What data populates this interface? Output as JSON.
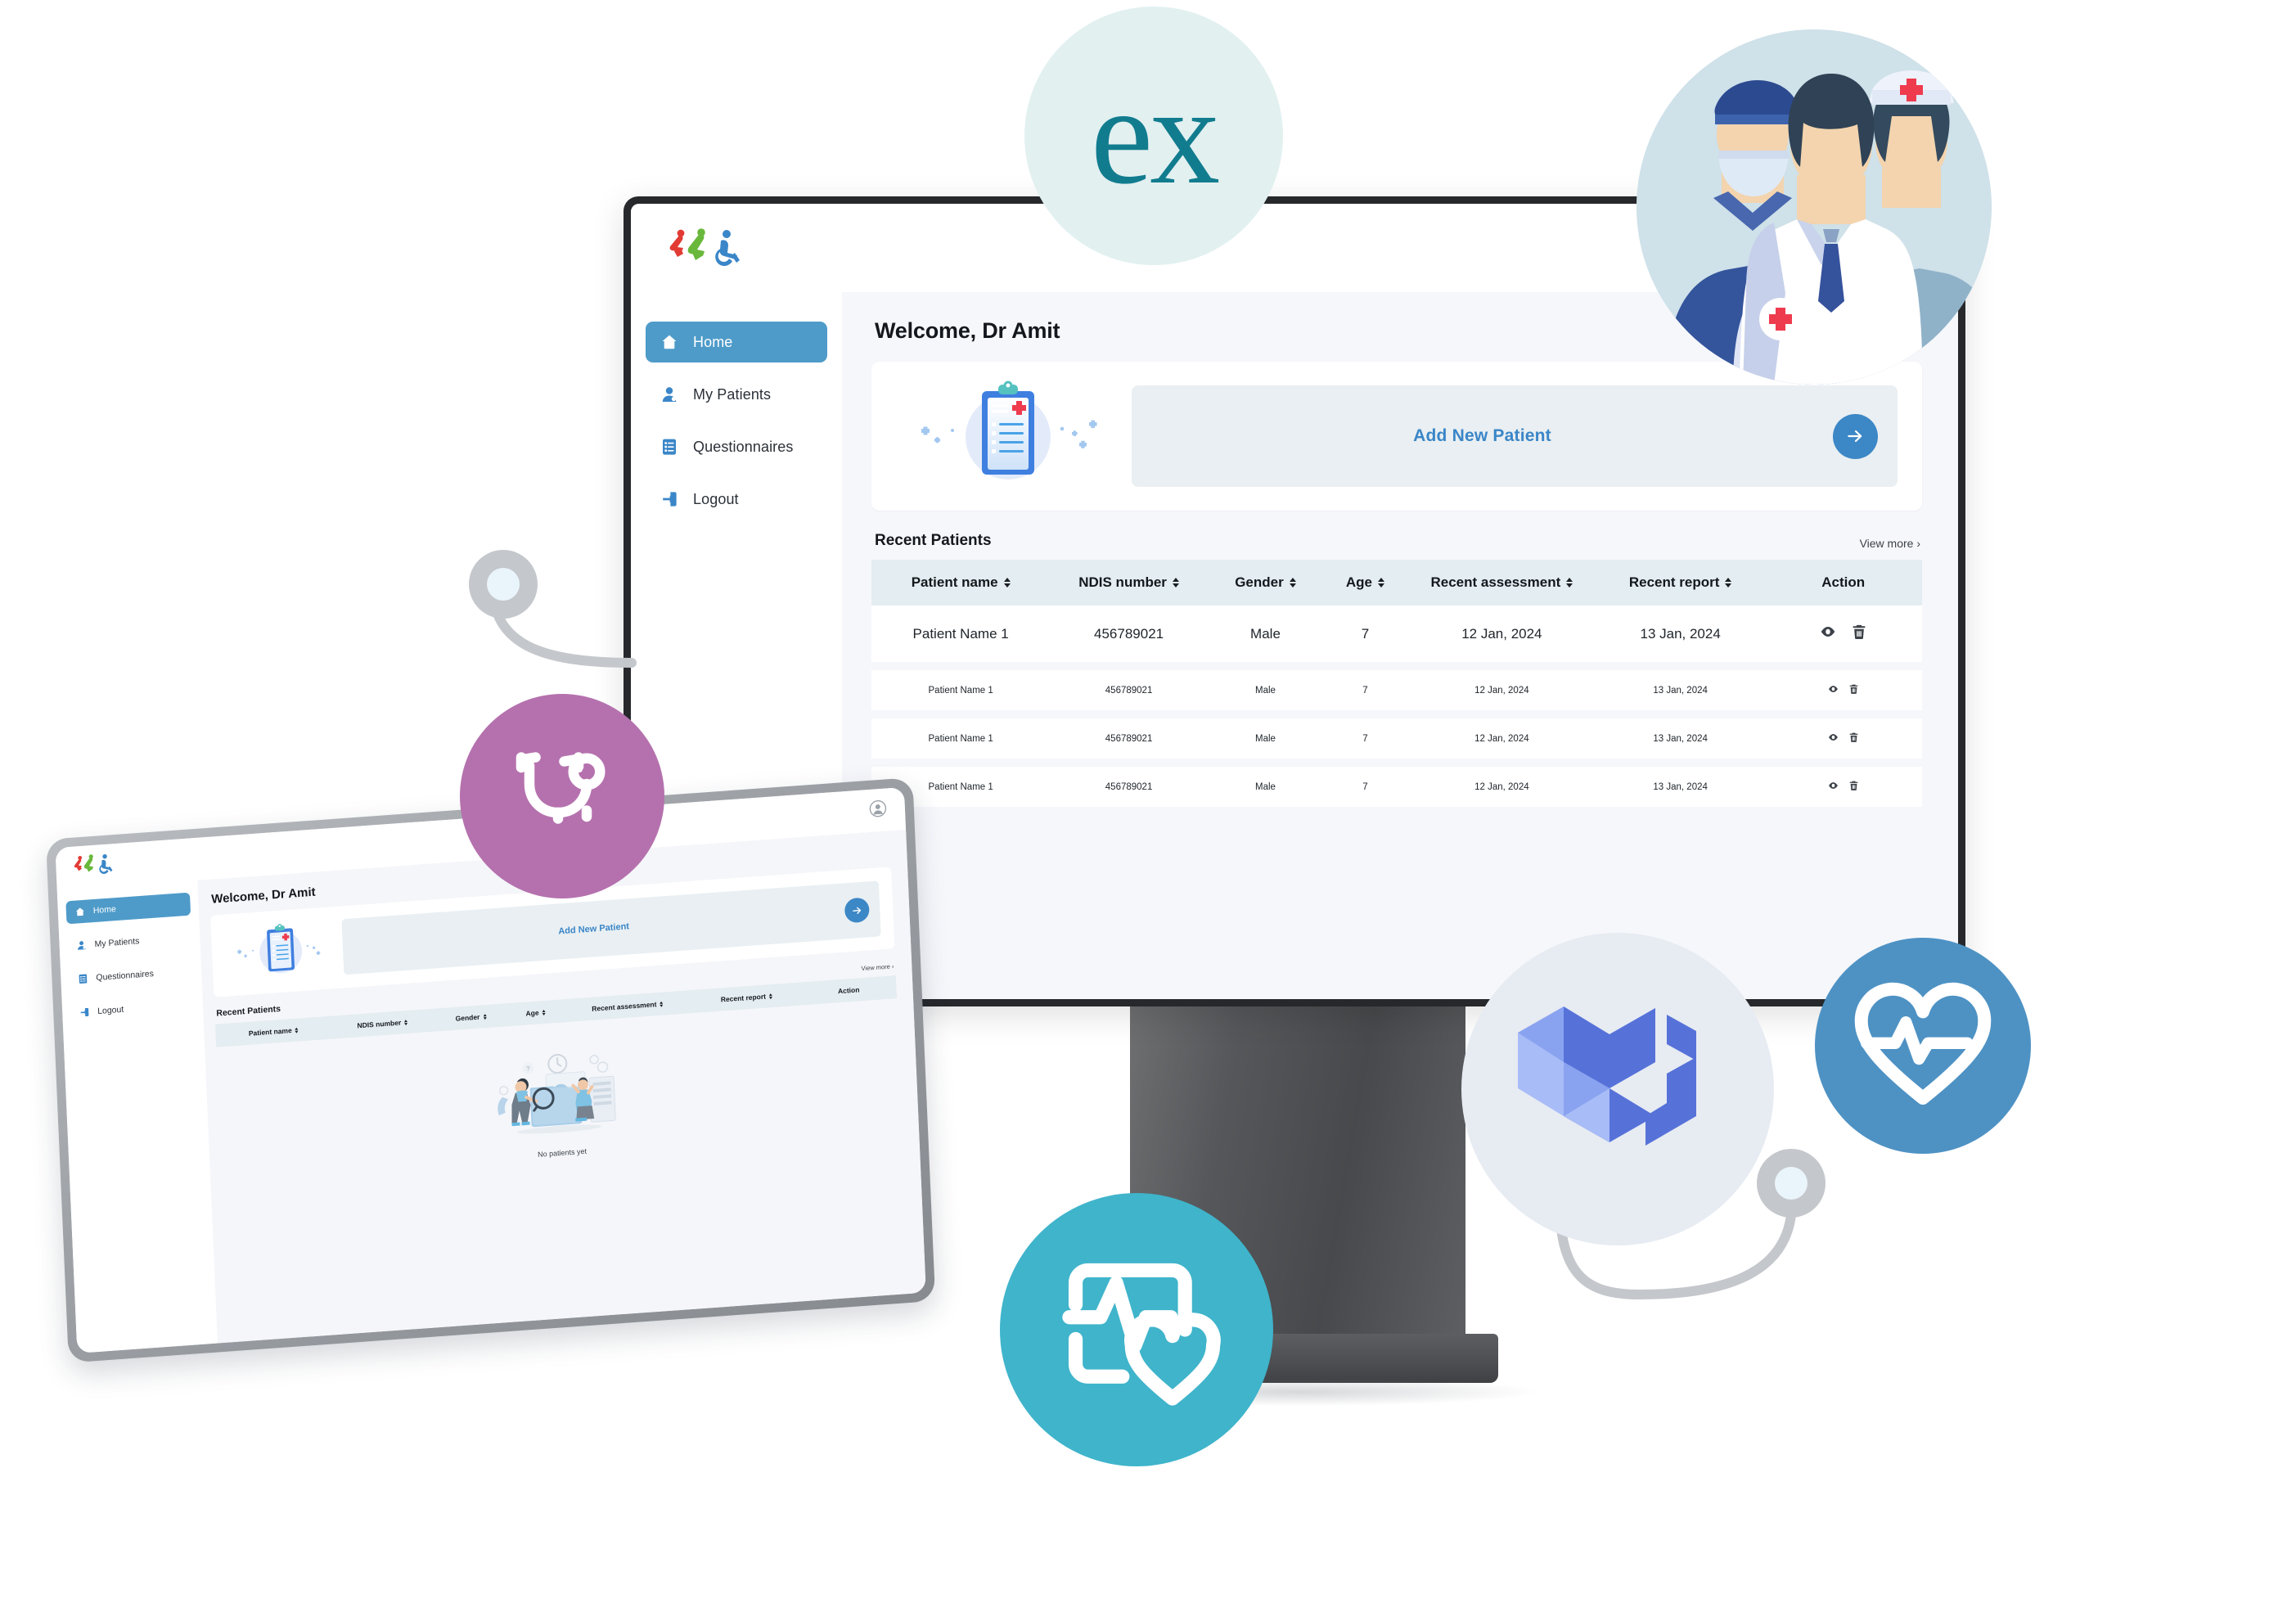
{
  "brand": {
    "logo_name": "accessibility-sport-logo"
  },
  "app": {
    "welcome": "Welcome, Dr Amit",
    "sidebar": {
      "items": [
        {
          "label": "Home",
          "icon": "home-icon",
          "active": true
        },
        {
          "label": "My Patients",
          "icon": "user-icon",
          "active": false
        },
        {
          "label": "Questionnaires",
          "icon": "clipboard-list-icon",
          "active": false
        },
        {
          "label": "Logout",
          "icon": "logout-icon",
          "active": false
        }
      ]
    },
    "add_patient": {
      "label": "Add New Patient",
      "arrow_icon": "arrow-right-icon",
      "illustration": "medical-clipboard-illustration"
    },
    "recent_patients": {
      "title": "Recent Patients",
      "view_more": "View more ›",
      "columns": [
        {
          "label": "Patient name",
          "sortable": true
        },
        {
          "label": "NDIS number",
          "sortable": true
        },
        {
          "label": "Gender",
          "sortable": true
        },
        {
          "label": "Age",
          "sortable": true
        },
        {
          "label": "Recent assessment",
          "sortable": true
        },
        {
          "label": "Recent report",
          "sortable": true
        },
        {
          "label": "Action",
          "sortable": false
        }
      ],
      "rows": [
        {
          "name": "Patient Name 1",
          "ndis": "456789021",
          "gender": "Male",
          "age": "7",
          "assessment": "12 Jan, 2024",
          "report": "13 Jan, 2024"
        },
        {
          "name": "Patient Name 1",
          "ndis": "456789021",
          "gender": "Male",
          "age": "7",
          "assessment": "12 Jan, 2024",
          "report": "13 Jan, 2024"
        },
        {
          "name": "Patient Name 1",
          "ndis": "456789021",
          "gender": "Male",
          "age": "7",
          "assessment": "12 Jan, 2024",
          "report": "13 Jan, 2024"
        },
        {
          "name": "Patient Name 1",
          "ndis": "456789021",
          "gender": "Male",
          "age": "7",
          "assessment": "12 Jan, 2024",
          "report": "13 Jan, 2024"
        }
      ],
      "action_icons": [
        "eye-view-icon",
        "trash-delete-icon"
      ]
    }
  },
  "tablet": {
    "welcome": "Welcome, Dr Amit",
    "avatar_icon": "account-circle-icon",
    "sidebar": {
      "items": [
        {
          "label": "Home",
          "icon": "home-icon",
          "active": true
        },
        {
          "label": "My Patients",
          "icon": "user-icon",
          "active": false
        },
        {
          "label": "Questionnaires",
          "icon": "clipboard-list-icon",
          "active": false
        },
        {
          "label": "Logout",
          "icon": "logout-icon",
          "active": false
        }
      ]
    },
    "add_patient": {
      "label": "Add New Patient",
      "arrow_icon": "arrow-right-icon"
    },
    "recent_patients": {
      "title": "Recent Patients",
      "view_more": "View more ›",
      "columns": [
        {
          "label": "Patient name",
          "sortable": true
        },
        {
          "label": "NDIS number",
          "sortable": true
        },
        {
          "label": "Gender",
          "sortable": true
        },
        {
          "label": "Age",
          "sortable": true
        },
        {
          "label": "Recent assessment",
          "sortable": true
        },
        {
          "label": "Recent report",
          "sortable": true
        },
        {
          "label": "Action",
          "sortable": false
        }
      ],
      "empty_state": {
        "text": "No patients yet",
        "illustration": "people-searching-folder-illustration"
      }
    }
  },
  "badges": [
    {
      "name": "express-logo-badge",
      "text": "ex",
      "bg": "#e2f0f0",
      "fg": "#127c8f"
    },
    {
      "name": "medical-team-badge",
      "bg": "#cfe1e9"
    },
    {
      "name": "stethoscope-badge",
      "bg": "#b571ae",
      "fg": "#ffffff"
    },
    {
      "name": "material-ui-logo-badge",
      "bg": "#e7ebf2"
    },
    {
      "name": "heart-pulse-badge",
      "bg": "#4e92c4",
      "fg": "#ffffff"
    },
    {
      "name": "health-monitor-badge",
      "bg": "#3fb4cb",
      "fg": "#ffffff"
    }
  ],
  "colors": {
    "accent_blue": "#4e9bc9",
    "link_blue": "#3a86c8",
    "table_header": "#e4edf1",
    "page_bg": "#f6f7fb",
    "monitor_bezel": "#26282b",
    "purple": "#b571ae",
    "teal": "#3fb4cb"
  }
}
